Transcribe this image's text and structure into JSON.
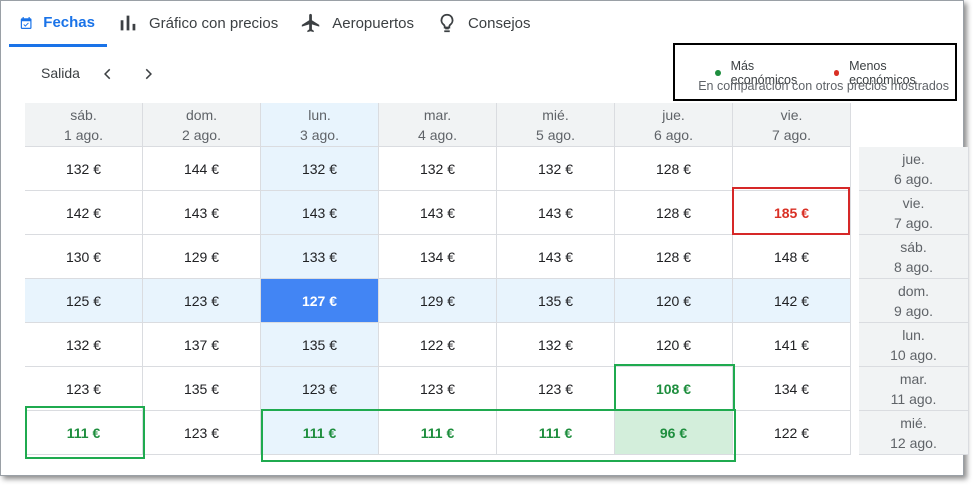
{
  "tabs": [
    {
      "label": "Fechas",
      "icon": "calendar-check-icon",
      "active": true
    },
    {
      "label": "Gráfico con precios",
      "icon": "bar-chart-icon",
      "active": false
    },
    {
      "label": "Aeropuertos",
      "icon": "airplane-icon",
      "active": false
    },
    {
      "label": "Consejos",
      "icon": "lightbulb-icon",
      "active": false
    }
  ],
  "legend": {
    "cheapest_label": "Más económicos",
    "cheapest_color": "#1e8e3e",
    "priciest_label": "Menos económicos",
    "priciest_color": "#d93025",
    "note": "En comparación con otros precios mostrados"
  },
  "departure": {
    "label": "Salida",
    "prev_icon": "chevron-left-icon",
    "next_icon": "chevron-right-icon"
  },
  "colors": {
    "accent": "#1a73e8",
    "selected_cell": "#4285f4",
    "selected_band": "#e8f4fd",
    "cheap_text": "#1e8e3e",
    "cheapest_bg": "#d3eedb",
    "expensive_text": "#d93025"
  },
  "grid": {
    "columns": [
      {
        "day": "sáb.",
        "date": "1 ago."
      },
      {
        "day": "dom.",
        "date": "2 ago."
      },
      {
        "day": "lun.",
        "date": "3 ago."
      },
      {
        "day": "mar.",
        "date": "4 ago."
      },
      {
        "day": "mié.",
        "date": "5 ago."
      },
      {
        "day": "jue.",
        "date": "6 ago."
      },
      {
        "day": "vie.",
        "date": "7 ago."
      }
    ],
    "rows": [
      {
        "day": "jue.",
        "date": "6 ago.",
        "prices": [
          "132 €",
          "144 €",
          "132 €",
          "132 €",
          "132 €",
          "128 €",
          ""
        ]
      },
      {
        "day": "vie.",
        "date": "7 ago.",
        "prices": [
          "142 €",
          "143 €",
          "143 €",
          "143 €",
          "143 €",
          "128 €",
          "185 €"
        ]
      },
      {
        "day": "sáb.",
        "date": "8 ago.",
        "prices": [
          "130 €",
          "129 €",
          "133 €",
          "134 €",
          "143 €",
          "128 €",
          "148 €"
        ]
      },
      {
        "day": "dom.",
        "date": "9 ago.",
        "prices": [
          "125 €",
          "123 €",
          "127 €",
          "129 €",
          "135 €",
          "120 €",
          "142 €"
        ]
      },
      {
        "day": "lun.",
        "date": "10 ago.",
        "prices": [
          "132 €",
          "137 €",
          "135 €",
          "122 €",
          "132 €",
          "120 €",
          "141 €"
        ]
      },
      {
        "day": "mar.",
        "date": "11 ago.",
        "prices": [
          "123 €",
          "135 €",
          "123 €",
          "123 €",
          "123 €",
          "108 €",
          "134 €"
        ]
      },
      {
        "day": "mié.",
        "date": "12 ago.",
        "prices": [
          "111 €",
          "123 €",
          "111 €",
          "111 €",
          "111 €",
          "96 €",
          "122 €"
        ]
      }
    ],
    "selected": {
      "row": 3,
      "col": 2
    },
    "cheap_cells": [
      [
        5,
        5
      ],
      [
        6,
        0
      ],
      [
        6,
        2
      ],
      [
        6,
        3
      ],
      [
        6,
        4
      ],
      [
        6,
        5
      ]
    ],
    "cheapest_cell": [
      6,
      5
    ],
    "expensive_cells": [
      [
        1,
        6
      ]
    ]
  }
}
